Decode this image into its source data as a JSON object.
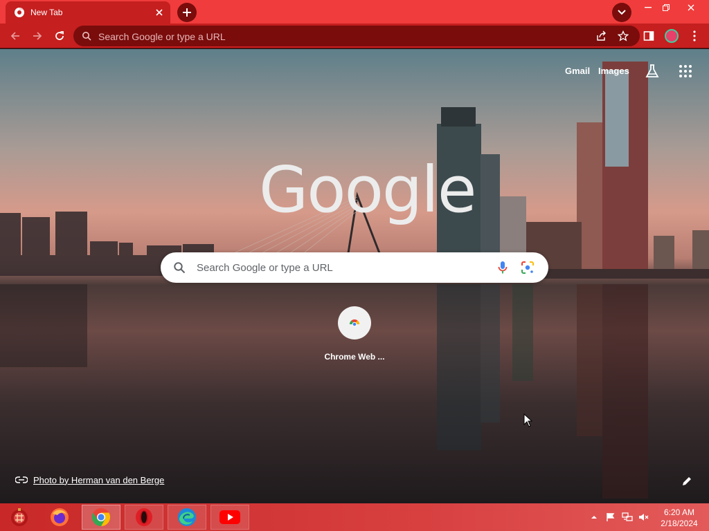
{
  "tabs": [
    {
      "title": "New Tab",
      "favicon": "chrome-icon",
      "active": true
    }
  ],
  "toolbar": {
    "omnibox_placeholder": "Search Google or type a URL"
  },
  "ntp": {
    "top_links": [
      "Gmail",
      "Images"
    ],
    "logo_text": "Google",
    "search_placeholder": "Search Google or type a URL",
    "shortcuts": [
      {
        "label": "Chrome Web ..."
      }
    ],
    "photo_credit": "Photo by Herman van den Berge"
  },
  "taskbar": {
    "apps": [
      "app-icon",
      "firefox-icon",
      "chrome-icon",
      "opera-icon",
      "edge-icon",
      "youtube-icon"
    ],
    "active_app": "chrome-icon",
    "clock_time": "6:20 AM",
    "clock_date": "2/18/2024"
  },
  "colors": {
    "titlebar": "#f03c3c",
    "toolbar": "#c51f1f",
    "omnibox": "#7a0c0c",
    "taskbar": "#c82828"
  }
}
